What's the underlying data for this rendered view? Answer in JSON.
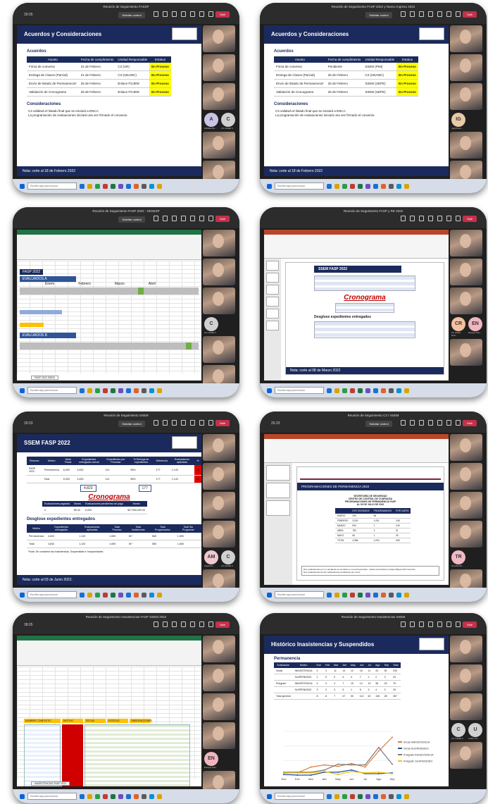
{
  "cards": [
    {
      "meeting_title": "Reunión de Seguimiento FASSP",
      "timer": "39:05",
      "share_label": "Solicitar control",
      "leave_label": "Salir",
      "slide": {
        "title": "Acuerdos y Consideraciones",
        "section_1": "Acuerdos",
        "headers": [
          "Asunto",
          "Fecha de cumplimiento",
          "Unidad Responsable",
          "Estatus"
        ],
        "rows": [
          [
            "Firma de convenio",
            "21 de Febrero",
            "C3 (UR)",
            "En Proceso"
          ],
          [
            "Entrega de Claves (Parcial)",
            "21 de Febrero",
            "C3 (UNAMC)",
            "En Proceso"
          ],
          [
            "Envío de listado de Permanencia*",
            "25 de Febrero",
            "Enlace FGJEM",
            "En Proceso"
          ],
          [
            "Validación de Cronograma",
            "25 de Febrero",
            "Enlace FGJEM",
            "En Proceso"
          ]
        ],
        "section_2": "Consideraciones",
        "notes": [
          "C3 validará el listado final que se enviará a ENCA.",
          "La programación de evaluaciones iniciará una vez firmado el convenio."
        ],
        "footer": "Nota: corte al 18 de Febrero 2022"
      },
      "avatars": [
        {
          "initial": "A",
          "name": "ANGELICA...",
          "color": "#c9c3e6"
        },
        {
          "initial": "C",
          "name": "C3 Unidad 3",
          "color": "#d0d0d0"
        }
      ]
    },
    {
      "meeting_title": "Reunión de Seguimiento FASP 2022 y Nuevo Ingreso 2022",
      "timer": "",
      "share_label": "Solicitar control",
      "leave_label": "Salir",
      "slide": {
        "title": "Acuerdos y Consideraciones",
        "section_1": "Acuerdos",
        "headers": [
          "Asunto",
          "Fecha de cumplimiento",
          "Unidad Responsable",
          "Estatus"
        ],
        "rows": [
          [
            "Firma de convenio",
            "Pendiente",
            "SSEM (PMI)",
            "En Proceso"
          ],
          [
            "Entrega de Claves (Parcial)",
            "25 de Febrero",
            "C3 (UNAMC)",
            "En Proceso"
          ],
          [
            "Envío de listado de Permanencia*",
            "25 de Febrero",
            "SSEM (UEPE)",
            "En Proceso"
          ],
          [
            "Validación de Cronograma",
            "25 de Febrero",
            "SSEM (UEPE)",
            "En Proceso"
          ]
        ],
        "section_2": "Consideraciones",
        "notes": [
          "C3 validará el listado final que se enviará a ENCA.",
          "La programación de evaluaciones iniciará una vez firmado el convenio."
        ],
        "footer": "Nota: corte al 18 de Febrero 2022"
      },
      "avatars": [
        {
          "initial": "IG",
          "name": "Ingrid Gon...",
          "color": "#e8c9a8"
        }
      ]
    },
    {
      "meeting_title": "Reunión de Seguimiento FASP 2022 - SESESP",
      "timer": "",
      "share_label": "Solicitar control",
      "leave_label": "Salir",
      "sheet": {
        "name": "FASP 2022",
        "section_a": "EVALUADOS A",
        "section_b": "EVALUADOS B",
        "header_row": [
          "Enero",
          "Febrero",
          "Marzo",
          "Abril"
        ],
        "tab": "FASP 2022 SSEM"
      },
      "avatars": [
        {
          "initial": "C",
          "name": "C3 Unidad 3",
          "color": "#d0d0d0"
        }
      ],
      "presenter_name": "ALEJANDRO ESPINOSA RAMIREZ"
    },
    {
      "meeting_title": "Reunión de Seguimiento FASP y RE 2022",
      "timer": "",
      "share_label": "",
      "leave_label": "Salir",
      "slide": {
        "title": "SSEM FASP 2022",
        "crono": "Cronograma",
        "section": "Desglose expedientes entregados",
        "footer": "Nota: corte al 08 de Marzo 2022"
      },
      "avatars": [
        {
          "initial": "CR",
          "name": "CX Ustiko Ruiz...",
          "color": "#f3c1a0"
        },
        {
          "initial": "EN",
          "name": "Enrique Nav...",
          "color": "#f0b6c0"
        }
      ]
    },
    {
      "meeting_title": "Reunión de Seguimiento SSEM",
      "timer": "39:03",
      "share_label": "Solicitar control",
      "leave_label": "Salir",
      "slide": {
        "title": "SSEM FASP 2022",
        "top_headers": [
          "Recurso",
          "Motivo",
          "Meta Fiscal",
          "Expedientes entregados a/eval",
          "Expedientes por Procesar",
          "% Entrega de expedientes",
          "Diferencia",
          "Evaluaciones aplicadas",
          "%"
        ],
        "top_rows": [
          [
            "FASP 2022",
            "Permanencia",
            "6,000",
            "4,833",
            "114",
            "98%",
            "177",
            "1,143",
            "24"
          ],
          [
            "",
            "Total",
            "6,000",
            "4,833",
            "114",
            "98%",
            "177",
            "1,143",
            "24"
          ]
        ],
        "highlight_left": "4,823",
        "highlight_right": "177",
        "crono": "Cronograma",
        "crono_headers": [
          "Evaluaciones pagadas",
          "Monto",
          "Evaluaciones pendientes de pago",
          "Monto"
        ],
        "crono_values": [
          "0",
          "$0.00",
          "6,000",
          "$27,900,000.00"
        ],
        "section": "Desglose expedientes entregados",
        "bottom_headers": [
          "Motivo",
          "Expedientes entregados",
          "Evaluaciones aplicadas",
          "Total Proceso",
          "Total Insistencias",
          "Total Programados",
          "Total Sin Programar"
        ],
        "bottom_rows": [
          [
            "Permanencia",
            "4,833",
            "1,143",
            "1,659",
            "51*",
            "565",
            "1,655"
          ],
          [
            "Total",
            "4,833",
            "1,143",
            "1,659",
            "51*",
            "565",
            "1,655"
          ]
        ],
        "note": "*Nota: Se considera las Inasistencias, Suspendidas e Incapacidades",
        "footer": "Nota: corte al 03 de Junio 2022."
      },
      "avatars": [
        {
          "initial": "AM",
          "name": "Alejandro ...",
          "color": "#f0c8d0"
        },
        {
          "initial": "C",
          "name": "C3 Unidad 3",
          "color": "#d0d0d0"
        }
      ]
    },
    {
      "meeting_title": "Reunión de Seguimiento C3 / SSEM",
      "timer": "26:29",
      "share_label": "Solicitar control",
      "leave_label": "Salir",
      "slide": {
        "title": "PROGRAMACIONES DE PERMANENCIA 2022",
        "subtitle_lines": [
          "SECRETARÍA DE SEGURIDAD",
          "CENTRO DE CONTROL DE CONFIANZA",
          "PROGRAMACIONES DE PERMANENCIA FASP",
          "AL 30 DE JULIO DE 2022"
        ],
        "table_headers": [
          "",
          "EXP. ENVIADOS",
          "PROGRAMADOS",
          "POR CARTA"
        ],
        "table_rows": [
          [
            "ENERO",
            "250",
            "66",
            ""
          ],
          [
            "FEBRERO",
            "3,000",
            "1,051",
            "248"
          ],
          [
            "MARZO",
            "900",
            "1",
            "249"
          ],
          [
            "ABRIL",
            "780",
            "3",
            "51"
          ],
          [
            "MAYO",
            "66",
            "1",
            "90"
          ],
          [
            "TOTAL",
            "4,986",
            "1,094",
            "638"
          ]
        ],
        "foot_lines": [
          "Dos evaluaciones por un pendiente se enviarán en su primera fecha - Carlos Luna Ibarra y Felipe Miguel Ortiz Guzmán",
          "Dos evaluaciones de las verificaciones pendientes por envío"
        ]
      },
      "avatars": [
        {
          "initial": "TR",
          "name": "Teresita Ro...",
          "color": "#f2b8c6"
        }
      ]
    },
    {
      "meeting_title": "Reunión de Seguimiento Inasistencias FASP SSEM 2022",
      "timer": "38:05",
      "share_label": "",
      "leave_label": "Salir",
      "sheet": {
        "name": "Libro1",
        "tab": "INASISTENCIAS FASP 2022",
        "col_headers": [
          "NOMBRE COMPLETO",
          "MOTIVO",
          "FECHA",
          "ESTATUS",
          "OBSERVACIONES"
        ]
      },
      "avatars": [
        {
          "initial": "EN",
          "name": "Enrique Nav...",
          "color": "#f0b6c0"
        }
      ]
    },
    {
      "meeting_title": "Reunión de Seguimiento Inasistencias SSEM",
      "timer": "",
      "share_label": "",
      "leave_label": "Salir",
      "slide": {
        "title": "Histórico Inasistencias y Suspendidos",
        "section": "Permanencia",
        "headers": [
          "Evaluación",
          "Motivo",
          "Ene",
          "Feb",
          "Mar",
          "Abr",
          "May",
          "Jun",
          "Jul",
          "Ago",
          "Sep",
          "Total"
        ],
        "rows": [
          [
            "Inicial",
            "INASISTENCIA",
            "3",
            "3",
            "11",
            "14",
            "12",
            "16",
            "11",
            "33",
            "52",
            "230"
          ],
          [
            "",
            "SUSPENDIDO",
            "1",
            "0",
            "0",
            "4",
            "4",
            "7",
            "2",
            "2",
            "3",
            "23"
          ],
          [
            "Polígrafo",
            "INASISTENCIA",
            "4",
            "4",
            "4",
            "7",
            "15",
            "14",
            "14",
            "38",
            "15",
            "75"
          ],
          [
            "",
            "SUSPENDIDO",
            "3",
            "3",
            "3",
            "5",
            "1",
            "5",
            "3",
            "4",
            "2",
            "29"
          ],
          [
            "Total general",
            "",
            "8",
            "8",
            "7",
            "47",
            "50",
            "112",
            "62",
            "136",
            "28",
            "357"
          ]
        ]
      },
      "chart_data": {
        "type": "line",
        "categories": [
          "Ene",
          "Feb",
          "Mar",
          "Abr",
          "May",
          "Jun",
          "Jul",
          "Ago",
          "Sep"
        ],
        "series": [
          {
            "name": "Inicial INASISTENCIA",
            "values": [
              3,
              3,
              11,
              14,
              12,
              16,
              11,
              33,
              52
            ]
          },
          {
            "name": "Inicial SUSPENDIDO",
            "values": [
              1,
              0,
              0,
              4,
              4,
              7,
              2,
              2,
              3
            ]
          },
          {
            "name": "Polígrafo INASISTENCIA",
            "values": [
              4,
              4,
              4,
              7,
              15,
              14,
              14,
              38,
              15
            ]
          },
          {
            "name": "Polígrafo SUSPENDIDO",
            "values": [
              3,
              3,
              3,
              5,
              1,
              5,
              3,
              4,
              2
            ]
          }
        ],
        "title": "",
        "xlabel": "",
        "ylabel": "",
        "ylim": [
          0,
          60
        ],
        "colors": [
          "#e07b39",
          "#1f4e9a",
          "#7a7a7a",
          "#f2c200"
        ]
      },
      "avatars": [
        {
          "initial": "C",
          "name": "C3 Unidad 3",
          "color": "#d0d0d0"
        },
        {
          "initial": "U",
          "name": "UTEC C3...",
          "color": "#d0d0d0"
        }
      ]
    }
  ],
  "taskbar": {
    "search_placeholder": "Escribe aquí para buscar"
  }
}
